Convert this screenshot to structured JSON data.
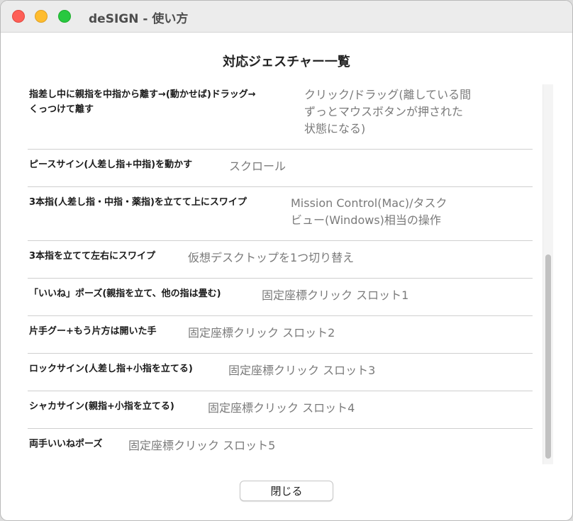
{
  "window": {
    "title": "deSIGN - 使い方"
  },
  "heading": "対応ジェスチャー一覧",
  "gestures": [
    {
      "gesture": "指差し中に親指を中指から離す→(動かせば)ドラッグ→\nくっつけて離す",
      "action": "クリック/ドラッグ(離している間\nずっとマウスボタンが押された\n状態になる)"
    },
    {
      "gesture": "ピースサイン(人差し指+中指)を動かす",
      "action": "スクロール"
    },
    {
      "gesture": "3本指(人差し指・中指・薬指)を立てて上にスワイプ",
      "action": "Mission Control(Mac)/タスク\nビュー(Windows)相当の操作"
    },
    {
      "gesture": "3本指を立てて左右にスワイプ",
      "action": "仮想デスクトップを1つ切り替え"
    },
    {
      "gesture": "「いいね」ポーズ(親指を立て、他の指は畳む)",
      "action": "固定座標クリック スロット1"
    },
    {
      "gesture": "片手グー+もう片方は開いた手",
      "action": "固定座標クリック スロット2"
    },
    {
      "gesture": "ロックサイン(人差し指+小指を立てる)",
      "action": "固定座標クリック スロット3"
    },
    {
      "gesture": "シャカサイン(親指+小指を立てる)",
      "action": "固定座標クリック スロット4"
    },
    {
      "gesture": "両手いいねポーズ",
      "action": "固定座標クリック スロット5"
    }
  ],
  "close_button": "閉じる",
  "colors": {
    "close": "#fe5f57",
    "minimize": "#febc2e",
    "maximize": "#28c840"
  }
}
